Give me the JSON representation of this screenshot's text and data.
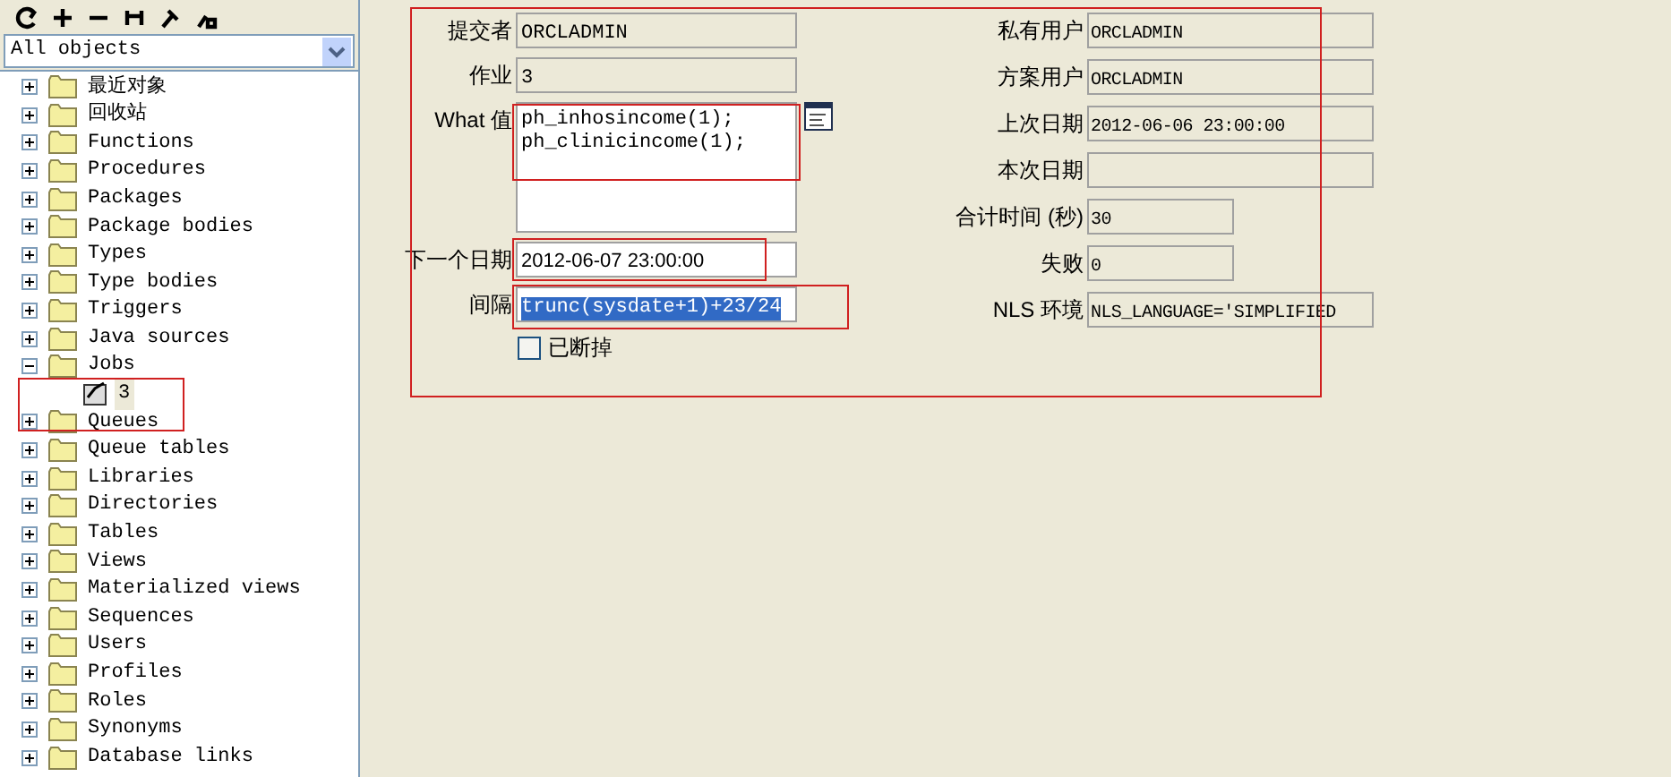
{
  "object_filter": {
    "value": "All objects"
  },
  "tree": [
    {
      "label": "最近对象",
      "expanded": false
    },
    {
      "label": "回收站",
      "expanded": false
    },
    {
      "label": "Functions",
      "expanded": false
    },
    {
      "label": "Procedures",
      "expanded": false
    },
    {
      "label": "Packages",
      "expanded": false
    },
    {
      "label": "Package bodies",
      "expanded": false
    },
    {
      "label": "Types",
      "expanded": false
    },
    {
      "label": "Type bodies",
      "expanded": false
    },
    {
      "label": "Triggers",
      "expanded": false
    },
    {
      "label": "Java sources",
      "expanded": false
    },
    {
      "label": "Jobs",
      "expanded": true,
      "children": [
        {
          "label": "3",
          "selected": true
        }
      ]
    },
    {
      "label": "Queues",
      "expanded": false
    },
    {
      "label": "Queue tables",
      "expanded": false
    },
    {
      "label": "Libraries",
      "expanded": false
    },
    {
      "label": "Directories",
      "expanded": false
    },
    {
      "label": "Tables",
      "expanded": false
    },
    {
      "label": "Views",
      "expanded": false
    },
    {
      "label": "Materialized views",
      "expanded": false
    },
    {
      "label": "Sequences",
      "expanded": false
    },
    {
      "label": "Users",
      "expanded": false
    },
    {
      "label": "Profiles",
      "expanded": false
    },
    {
      "label": "Roles",
      "expanded": false
    },
    {
      "label": "Synonyms",
      "expanded": false
    },
    {
      "label": "Database links",
      "expanded": false
    }
  ],
  "form_left": [
    {
      "kind": "text",
      "label": "提交者",
      "value": "ORCLADMIN",
      "editable": false,
      "highlighted": false
    },
    {
      "kind": "text",
      "label": "作业",
      "value": "3",
      "editable": false,
      "highlighted": false
    },
    {
      "kind": "textarea",
      "label": "What 值",
      "value": "ph_inhosincome(1);\nph_clinicincome(1);",
      "editable": true,
      "highlighted": false
    },
    {
      "kind": "text",
      "label": "下一个日期",
      "value": "2012-06-07 23:00:00",
      "editable": true,
      "highlighted": false
    },
    {
      "kind": "text",
      "label": "间隔",
      "value": "trunc(sysdate+1)+23/24",
      "editable": true,
      "highlighted": true
    }
  ],
  "broken": {
    "label": "已断掉",
    "checked": false
  },
  "form_right": [
    {
      "kind": "wide",
      "label": "私有用户",
      "value": "ORCLADMIN"
    },
    {
      "kind": "wide",
      "label": "方案用户",
      "value": "ORCLADMIN"
    },
    {
      "kind": "wide",
      "label": "上次日期",
      "value": "2012-06-06 23:00:00"
    },
    {
      "kind": "wide",
      "label": "本次日期"
    },
    {
      "kind": "narrow",
      "label": "合计时间 (秒)",
      "value": "30"
    },
    {
      "kind": "narrow",
      "label": "失败",
      "value": "0"
    },
    {
      "kind": "wide",
      "label": "NLS 环境",
      "value": "NLS_LANGUAGE='SIMPLIFIED"
    }
  ]
}
